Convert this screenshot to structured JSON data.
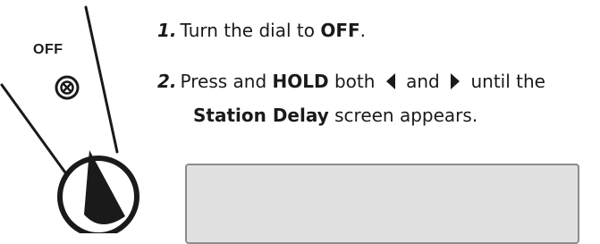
{
  "dial": {
    "position_label": "OFF",
    "icon": "off-symbol-icon"
  },
  "steps": [
    {
      "number": "1.",
      "text_before": "Turn the dial to ",
      "bold": "OFF",
      "text_after": "."
    },
    {
      "number": "2.",
      "text_before": "Press and ",
      "bold": "HOLD",
      "text_mid": " both ",
      "left_arrow_icon": "left-arrow-icon",
      "text_and": " and ",
      "right_arrow_icon": "right-arrow-icon",
      "text_after": " until the",
      "bold_2": "Station Delay",
      "text_end": " screen appears."
    }
  ],
  "colors": {
    "text": "#1a1a1a",
    "screen_fill": "#e1e1e1",
    "screen_border": "#8c8c8c"
  }
}
